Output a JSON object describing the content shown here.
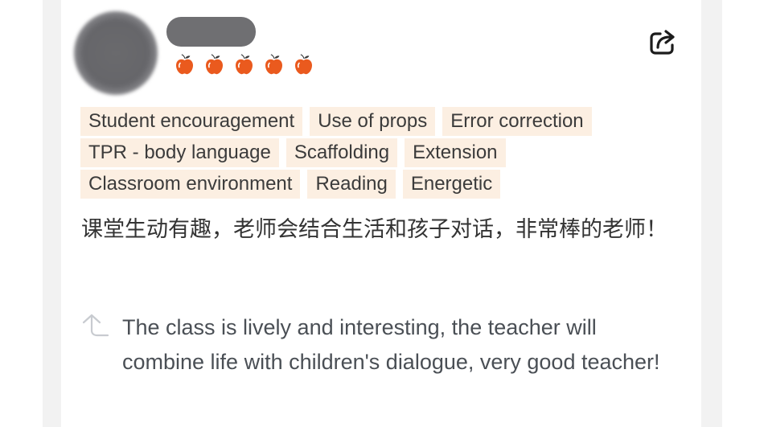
{
  "review": {
    "rating_count": 5,
    "tags": [
      [
        "Student encouragement",
        "Use of props",
        "Error correction"
      ],
      [
        "TPR - body language",
        "Scaffolding",
        "Extension"
      ],
      [
        "Classroom environment",
        "Reading",
        "Energetic"
      ]
    ],
    "text": "课堂生动有趣，老师会结合生活和孩子对话，非常棒的老师！",
    "translation": "The class is lively and interesting, the teacher will combine life with children's dialogue, very good teacher!"
  },
  "icons": {
    "rating": "apple-icon",
    "share": "share-icon",
    "translate": "translate-icon"
  },
  "colors": {
    "apple": "#ea5a1e",
    "tag_background": "#fcefe2",
    "text": "#333333"
  }
}
